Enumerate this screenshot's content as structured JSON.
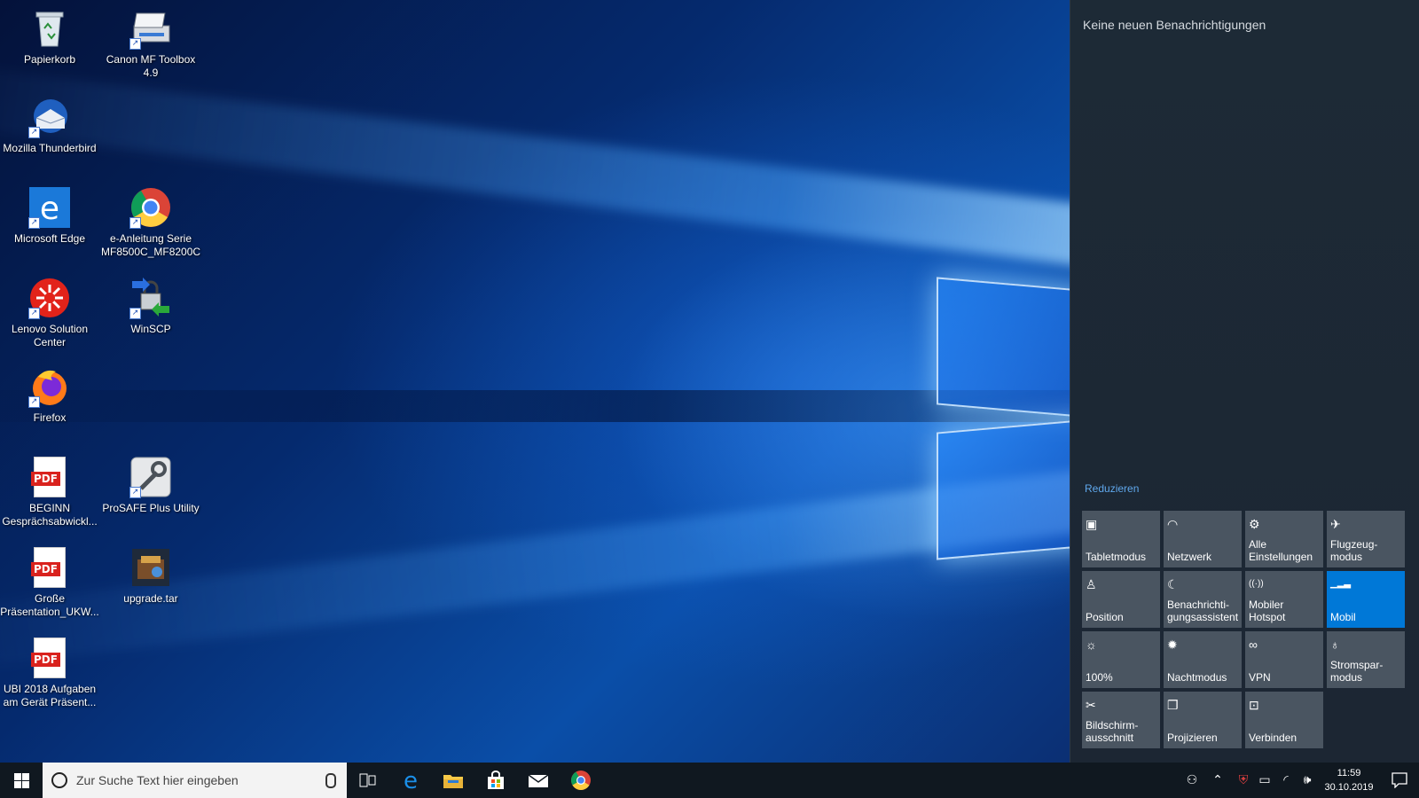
{
  "desktop": {
    "icons": [
      {
        "label": "Papierkorb",
        "icon": "recycle-bin-icon"
      },
      {
        "label": "Canon MF Toolbox 4.9",
        "icon": "scanner-icon"
      },
      {
        "label": "Mozilla Thunderbird",
        "icon": "thunderbird-icon"
      },
      {
        "label": "Microsoft Edge",
        "icon": "edge-icon"
      },
      {
        "label": "e-Anleitung Serie MF8500C_MF8200C",
        "icon": "chrome-icon"
      },
      {
        "label": "Lenovo Solution Center",
        "icon": "lenovo-icon"
      },
      {
        "label": "WinSCP",
        "icon": "winscp-icon"
      },
      {
        "label": "Firefox",
        "icon": "firefox-icon"
      },
      {
        "label": "BEGINN Gesprächsabwickl...",
        "icon": "pdf-icon",
        "badge": "PDF"
      },
      {
        "label": "ProSAFE Plus Utility",
        "icon": "prosafe-icon"
      },
      {
        "label": "Große Präsentation_UKW...",
        "icon": "pdf-icon",
        "badge": "PDF"
      },
      {
        "label": "upgrade.tar",
        "icon": "archive-icon"
      },
      {
        "label": "UBI 2018 Aufgaben am Gerät Präsent...",
        "icon": "pdf-icon",
        "badge": "PDF"
      }
    ]
  },
  "action_center": {
    "empty_text": "Keine neuen Benachrichtigungen",
    "collapse_label": "Reduzieren",
    "tiles": [
      {
        "label": "Tabletmodus",
        "icon": "tablet-icon",
        "active": false
      },
      {
        "label": "Netzwerk",
        "icon": "network-icon",
        "active": false
      },
      {
        "label": "Alle\nEinstellungen",
        "icon": "gear-icon",
        "active": false
      },
      {
        "label": "Flugzeug-\nmodus",
        "icon": "airplane-icon",
        "active": false
      },
      {
        "label": "Position",
        "icon": "location-icon",
        "active": false
      },
      {
        "label": "Benachrichti-\ngungsassistent",
        "icon": "moon-icon",
        "active": false
      },
      {
        "label": "Mobiler\nHotspot",
        "icon": "hotspot-icon",
        "active": false
      },
      {
        "label": "Mobil",
        "icon": "cellular-icon",
        "active": true
      },
      {
        "label": "100%",
        "icon": "brightness-icon",
        "active": false
      },
      {
        "label": "Nachtmodus",
        "icon": "night-light-icon",
        "active": false
      },
      {
        "label": "VPN",
        "icon": "vpn-icon",
        "active": false
      },
      {
        "label": "Stromspar-\nmodus",
        "icon": "battery-saver-icon",
        "active": false
      },
      {
        "label": "Bildschirm-\nausschnitt",
        "icon": "snip-icon",
        "active": false
      },
      {
        "label": "Projizieren",
        "icon": "project-icon",
        "active": false
      },
      {
        "label": "Verbinden",
        "icon": "connect-icon",
        "active": false
      }
    ]
  },
  "taskbar": {
    "search_placeholder": "Zur Suche Text hier eingeben",
    "clock_time": "11:59",
    "clock_date": "30.10.2019"
  }
}
